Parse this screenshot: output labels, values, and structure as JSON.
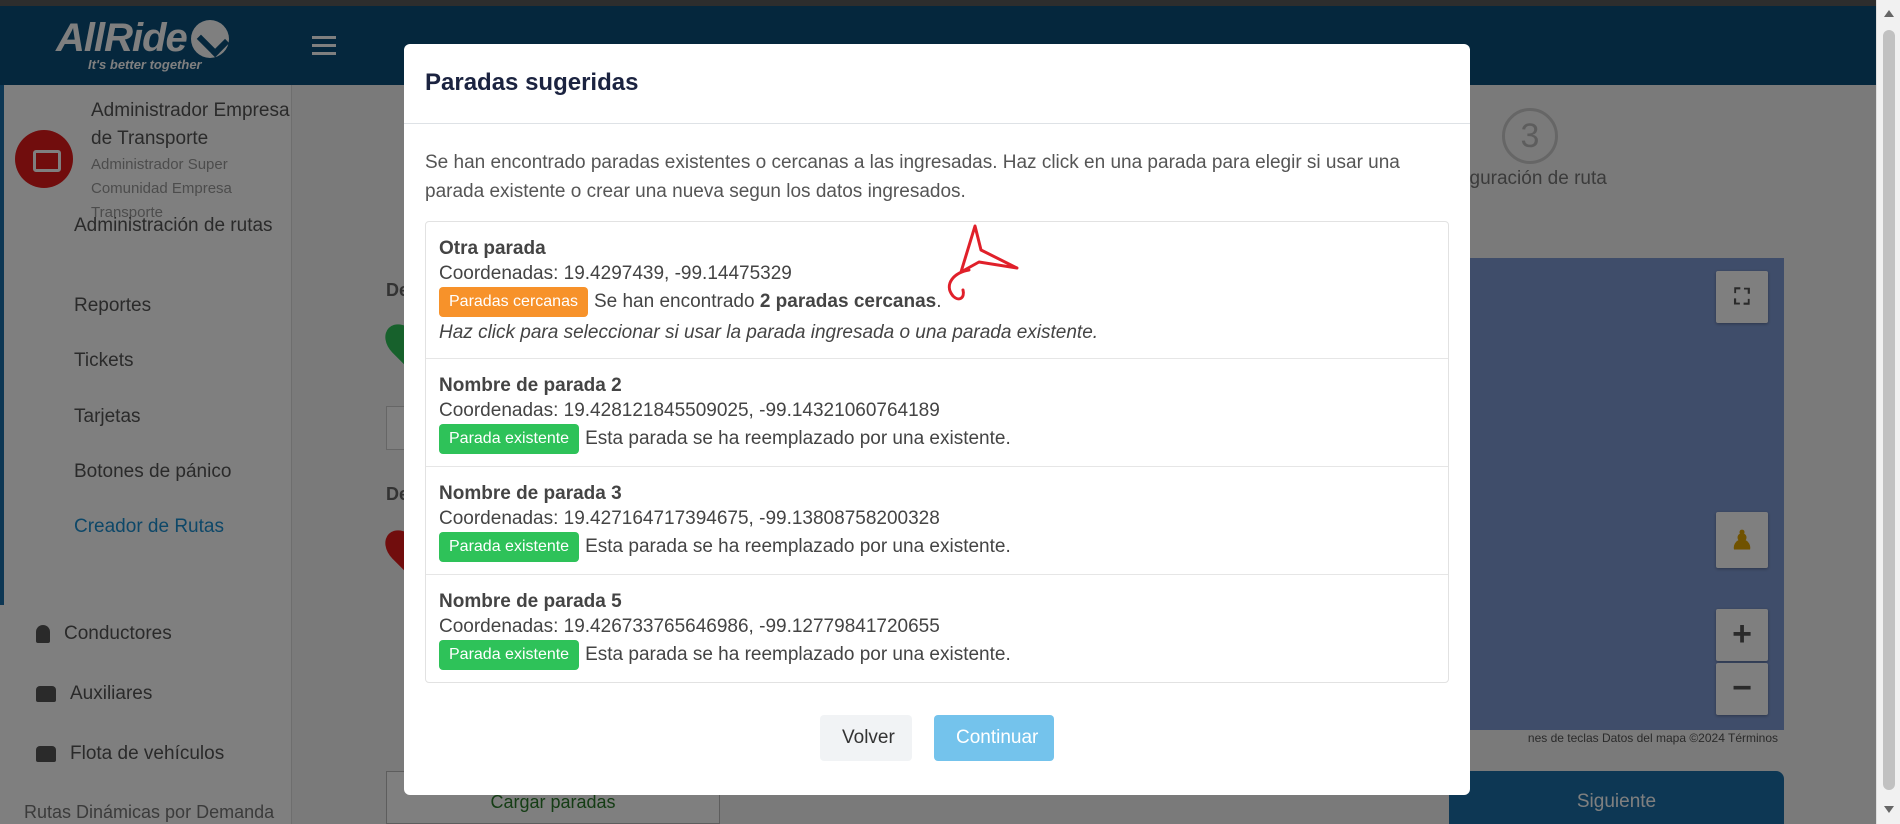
{
  "app": {
    "brand": "AllRide",
    "tagline": "It's better together"
  },
  "user": {
    "name": "Administrador Empresa de Transporte",
    "roles": "Administrador Super Comunidad Empresa Transporte"
  },
  "sidebar": {
    "sub_items": [
      {
        "label": "Administración de rutas"
      },
      {
        "label": "Reportes"
      },
      {
        "label": "Tickets"
      },
      {
        "label": "Tarjetas"
      },
      {
        "label": "Botones de pánico"
      },
      {
        "label": "Creador de Rutas"
      }
    ],
    "main_items": [
      {
        "label": "Conductores",
        "icon": "person-icon"
      },
      {
        "label": "Auxiliares",
        "icon": "group-icon"
      },
      {
        "label": "Flota de vehículos",
        "icon": "bus-icon"
      }
    ],
    "bottom_item": "Rutas Dinámicas por Demanda"
  },
  "wizard": {
    "step_number": "3",
    "step_label": "figuración de ruta",
    "label_a": "De",
    "label_b": "De"
  },
  "background": {
    "upload_label": "Cargar paradas",
    "next_label": "Siguiente",
    "map_footer": "nes de teclas   Datos del mapa ©2024   Términos"
  },
  "modal": {
    "title": "Paradas sugeridas",
    "intro": "Se han encontrado paradas existentes o cercanas a las ingresadas. Haz click en una parada para elegir si usar una parada existente o crear una nueva segun los datos ingresados.",
    "stops": [
      {
        "name": "Otra parada",
        "coords": "Coordenadas: 19.4297439, -99.14475329",
        "badge": "Paradas cercanas",
        "status_prefix": "Se han encontrado ",
        "status_bold": "2 paradas cercanas",
        "status_suffix": ".",
        "hint": "Haz click para seleccionar si usar la parada ingresada o una parada existente."
      },
      {
        "name": "Nombre de parada 2",
        "coords": "Coordenadas: 19.428121845509025, -99.14321060764189",
        "badge": "Parada existente",
        "status": "Esta parada se ha reemplazado por una existente."
      },
      {
        "name": "Nombre de parada 3",
        "coords": "Coordenadas: 19.427164717394675, -99.13808758200328",
        "badge": "Parada existente",
        "status": "Esta parada se ha reemplazado por una existente."
      },
      {
        "name": "Nombre de parada 5",
        "coords": "Coordenadas: 19.426733765646986, -99.12779841720655",
        "badge": "Parada existente",
        "status": "Esta parada se ha reemplazado por una existente."
      }
    ],
    "back_label": "Volver",
    "continue_label": "Continuar"
  },
  "colors": {
    "topbar": "#0a4f7a",
    "badge_orange": "#f7922a",
    "badge_green": "#2ec259",
    "continue": "#74c3ec",
    "annotation": "#e0202a"
  }
}
